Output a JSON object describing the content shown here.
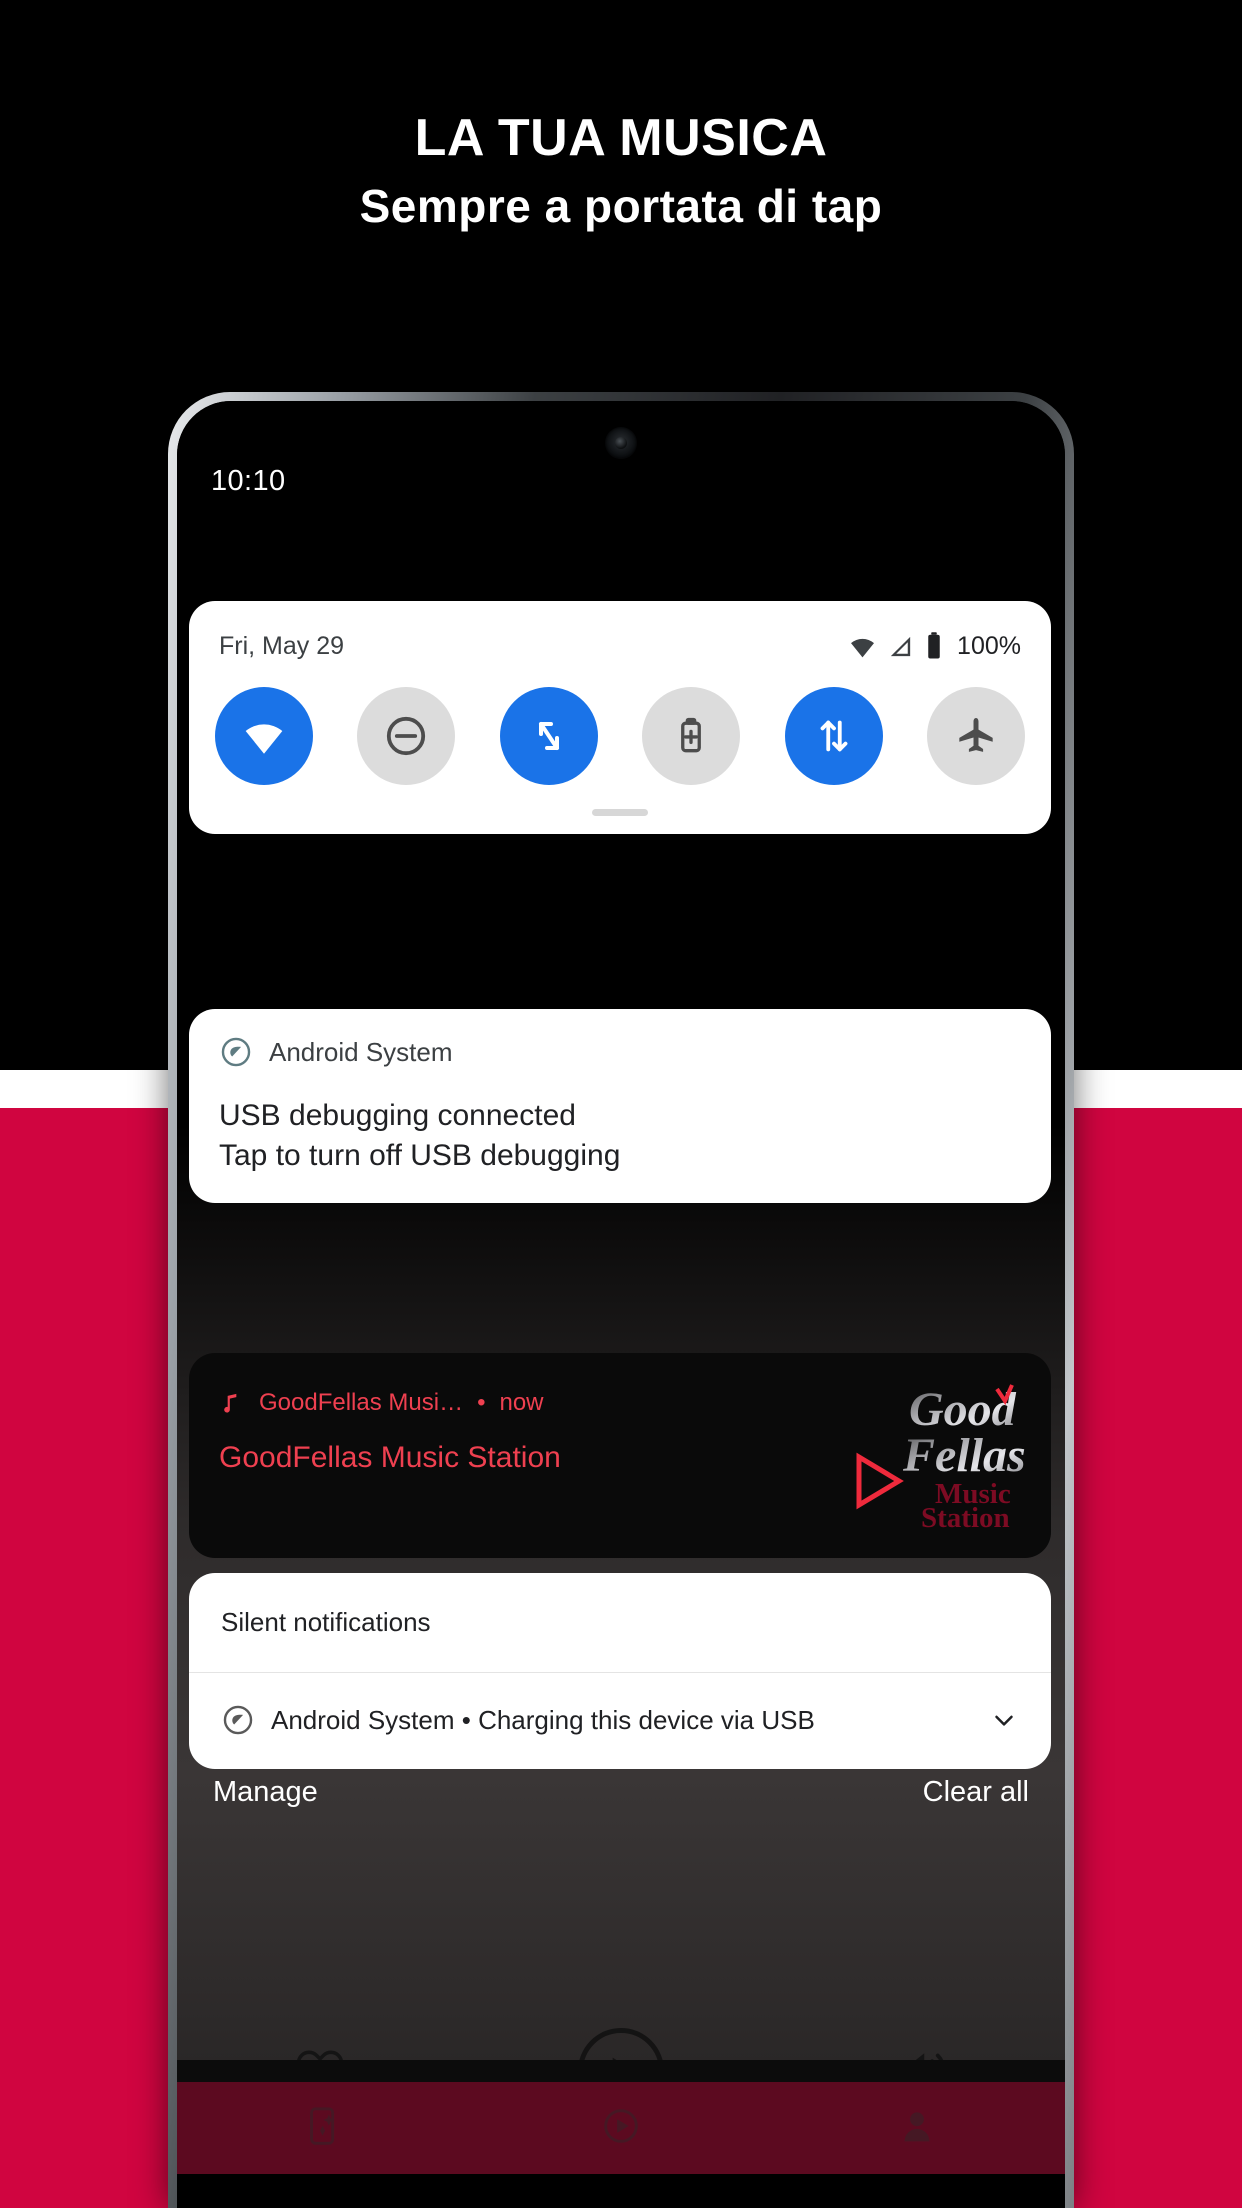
{
  "promo": {
    "headline_line1": "LA TUA MUSICA",
    "headline_line2": "Sempre a portata di tap",
    "background_top_color": "#000000",
    "background_band_color": "#FFFFFF",
    "background_bottom_color": "#D00540"
  },
  "phone": {
    "status_bar": {
      "clock": "10:10"
    },
    "quick_settings": {
      "date": "Fri, May 29",
      "battery_percent": "100%",
      "status_icons": [
        "wifi-icon",
        "signal-icon",
        "battery-icon"
      ],
      "tiles": [
        {
          "name": "wifi-tile",
          "icon": "wifi-icon",
          "state": "on"
        },
        {
          "name": "do-not-disturb-tile",
          "icon": "do-not-disturb-icon",
          "state": "off"
        },
        {
          "name": "auto-rotate-tile",
          "icon": "auto-rotate-icon",
          "state": "on"
        },
        {
          "name": "battery-saver-tile",
          "icon": "battery-saver-icon",
          "state": "off"
        },
        {
          "name": "mobile-data-tile",
          "icon": "mobile-data-icon",
          "state": "on"
        },
        {
          "name": "airplane-mode-tile",
          "icon": "airplane-icon",
          "state": "off"
        }
      ],
      "accent_on_color": "#1A73E8",
      "accent_off_color": "#DCDCDC"
    },
    "notifications": {
      "system": {
        "app_name": "Android System",
        "title": "USB debugging connected",
        "subtitle": "Tap to turn off USB debugging"
      },
      "media": {
        "app_name": "GoodFellas Musi…",
        "separator": "•",
        "time": "now",
        "title": "GoodFellas Music Station",
        "accent_color": "#EF4050",
        "artwork": {
          "line1": "Good",
          "line2": "Fellas",
          "line3": "Music",
          "line4": "Station"
        }
      },
      "silent": {
        "header": "Silent notifications",
        "row_text": "Android System • Charging this device via USB",
        "expand_icon": "chevron-down-icon"
      }
    },
    "shade_actions": {
      "manage": "Manage",
      "clear_all": "Clear all"
    },
    "player_controls": [
      {
        "name": "favorite-button",
        "icon": "heart-icon"
      },
      {
        "name": "play-button",
        "icon": "play-icon"
      },
      {
        "name": "volume-button",
        "icon": "volume-icon"
      }
    ],
    "bottom_nav": [
      {
        "name": "nav-discover",
        "icon": "sparkle-card-icon"
      },
      {
        "name": "nav-play",
        "icon": "play-circle-icon"
      },
      {
        "name": "nav-profile",
        "icon": "account-icon"
      }
    ],
    "bottom_nav_color": "#5C0A20"
  }
}
